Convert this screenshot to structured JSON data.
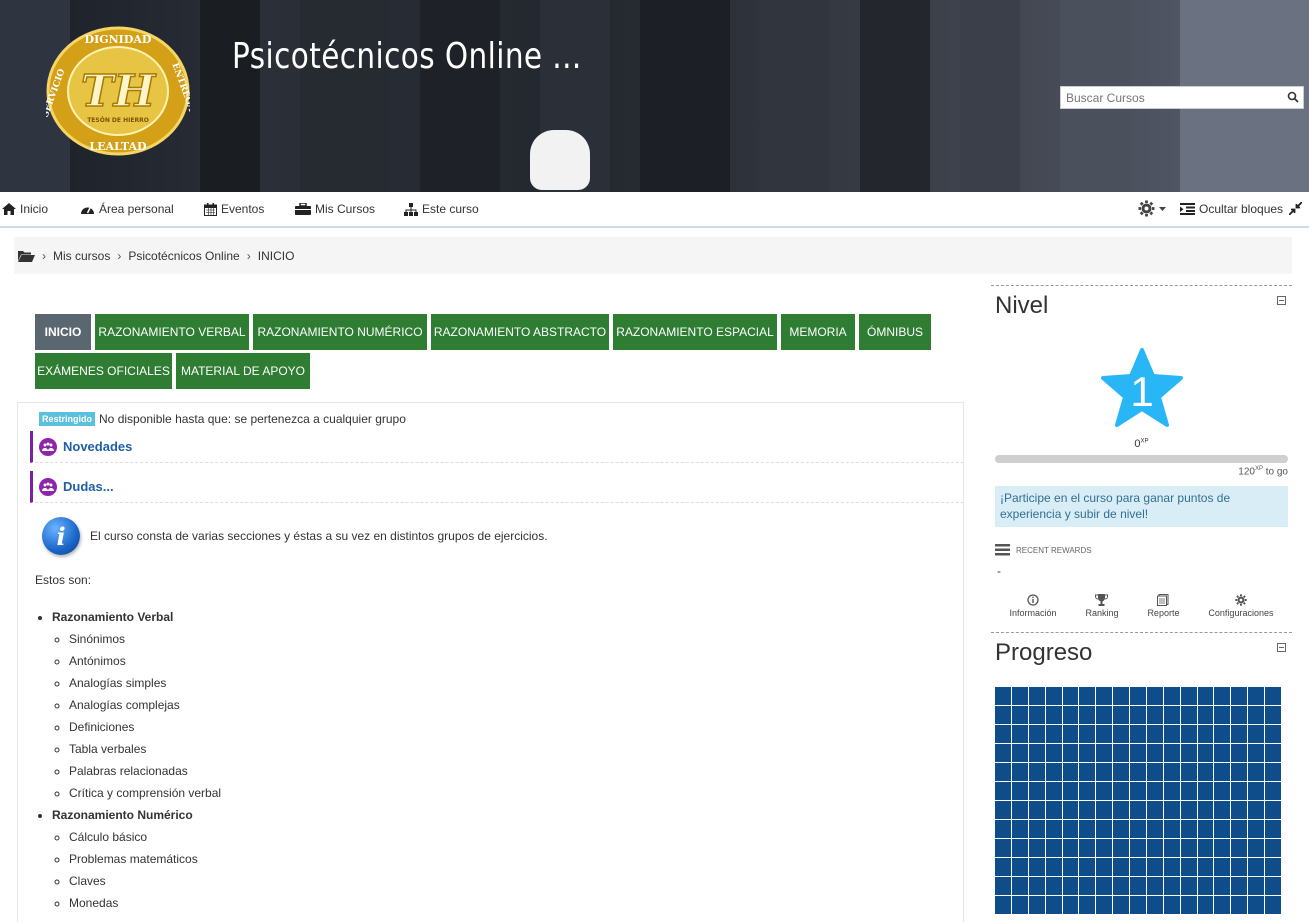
{
  "header": {
    "site_title": "Psicotécnicos Online ...",
    "logo_text_top": "DIGNIDAD",
    "logo_text_left": "SERVICIO",
    "logo_text_right": "ENTREGA",
    "logo_text_bottom": "LEALTAD",
    "logo_monogram": "TH",
    "logo_subtitle": "TESÓN DE HIERRO",
    "search": {
      "placeholder": "Buscar Cursos",
      "icon": "search-icon"
    }
  },
  "navbar": {
    "items": [
      {
        "label": "Inicio",
        "icon": "home-icon"
      },
      {
        "label": "Área personal",
        "icon": "dashboard-icon"
      },
      {
        "label": "Eventos",
        "icon": "calendar-icon"
      },
      {
        "label": "Mis Cursos",
        "icon": "briefcase-icon"
      },
      {
        "label": "Este curso",
        "icon": "sitemap-icon"
      }
    ],
    "hide_blocks_label": "Ocultar bloques"
  },
  "breadcrumb": {
    "items": [
      "Mis cursos",
      "Psicotécnicos Online",
      "INICIO"
    ]
  },
  "tabs": [
    {
      "label": "INICIO",
      "active": true
    },
    {
      "label": "RAZONAMIENTO VERBAL"
    },
    {
      "label": "RAZONAMIENTO NUMÉRICO"
    },
    {
      "label": "RAZONAMIENTO ABSTRACTO"
    },
    {
      "label": "RAZONAMIENTO ESPACIAL"
    },
    {
      "label": "MEMORIA"
    },
    {
      "label": "ÓMNIBUS"
    },
    {
      "label": "EXÁMENES OFICIALES"
    },
    {
      "label": "MATERIAL DE APOYO"
    }
  ],
  "section": {
    "restricted_badge": "Restringido",
    "restricted_text": "No disponible hasta que: se pertenezca a cualquier grupo",
    "forums": [
      {
        "label": "Novedades"
      },
      {
        "label": "Dudas..."
      }
    ],
    "info_text": "El curso consta de varias secciones y éstas a su vez en distintos grupos de ejercicios.",
    "estos_text": "Estos son:",
    "topics": [
      {
        "title": "Razonamiento Verbal",
        "items": [
          "Sinónimos",
          "Antónimos",
          "Analogías simples",
          "Analogías complejas",
          "Definiciones",
          "Tabla verbales",
          "Palabras relacionadas",
          "Crítica y comprensión verbal"
        ]
      },
      {
        "title": "Razonamiento Numérico",
        "items": [
          "Cálculo básico",
          "Problemas matemáticos",
          "Claves",
          "Monedas"
        ]
      }
    ]
  },
  "nivel_block": {
    "title": "Nivel",
    "level": "1",
    "xp": "0",
    "xp_unit": "XP",
    "progress_fraction": 0,
    "to_go": "120",
    "to_go_label": "to go",
    "notice": "¡Participe en el curso para ganar puntos de experiencia y subir de nivel!",
    "recent_rewards": "RECENT REWARDS",
    "recent_value": "-",
    "links": [
      "Información",
      "Ranking",
      "Reporte",
      "Configuraciones"
    ]
  },
  "progreso_block": {
    "title": "Progreso"
  },
  "colors": {
    "tab_green": "#2e7d32",
    "tab_active": "#5b6770",
    "star": "#29b6f6",
    "progress_cell": "#0e4d8a",
    "forum_purple": "#8e24aa"
  }
}
